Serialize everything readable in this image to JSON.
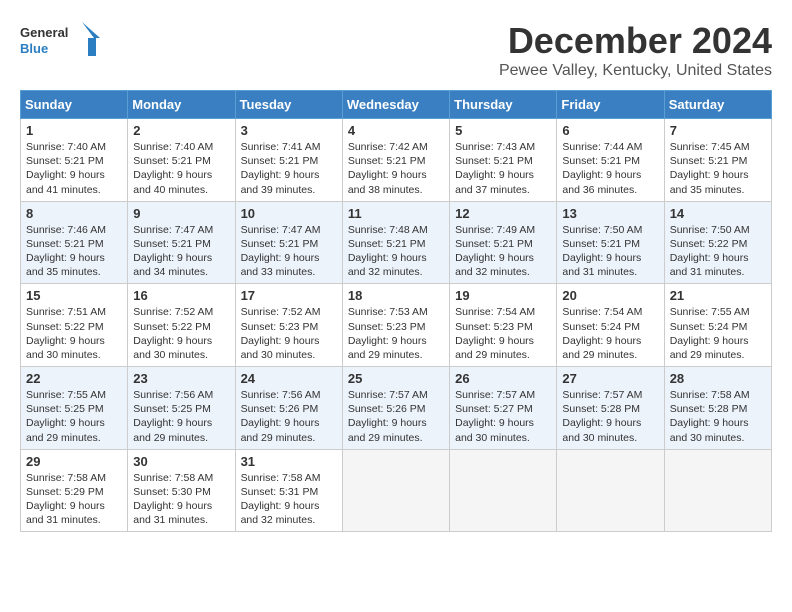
{
  "logo": {
    "line1": "General",
    "line2": "Blue"
  },
  "title": "December 2024",
  "location": "Pewee Valley, Kentucky, United States",
  "days_of_week": [
    "Sunday",
    "Monday",
    "Tuesday",
    "Wednesday",
    "Thursday",
    "Friday",
    "Saturday"
  ],
  "weeks": [
    [
      {
        "day": "1",
        "sunrise": "7:40 AM",
        "sunset": "5:21 PM",
        "daylight": "9 hours and 41 minutes."
      },
      {
        "day": "2",
        "sunrise": "7:40 AM",
        "sunset": "5:21 PM",
        "daylight": "9 hours and 40 minutes."
      },
      {
        "day": "3",
        "sunrise": "7:41 AM",
        "sunset": "5:21 PM",
        "daylight": "9 hours and 39 minutes."
      },
      {
        "day": "4",
        "sunrise": "7:42 AM",
        "sunset": "5:21 PM",
        "daylight": "9 hours and 38 minutes."
      },
      {
        "day": "5",
        "sunrise": "7:43 AM",
        "sunset": "5:21 PM",
        "daylight": "9 hours and 37 minutes."
      },
      {
        "day": "6",
        "sunrise": "7:44 AM",
        "sunset": "5:21 PM",
        "daylight": "9 hours and 36 minutes."
      },
      {
        "day": "7",
        "sunrise": "7:45 AM",
        "sunset": "5:21 PM",
        "daylight": "9 hours and 35 minutes."
      }
    ],
    [
      {
        "day": "8",
        "sunrise": "7:46 AM",
        "sunset": "5:21 PM",
        "daylight": "9 hours and 35 minutes."
      },
      {
        "day": "9",
        "sunrise": "7:47 AM",
        "sunset": "5:21 PM",
        "daylight": "9 hours and 34 minutes."
      },
      {
        "day": "10",
        "sunrise": "7:47 AM",
        "sunset": "5:21 PM",
        "daylight": "9 hours and 33 minutes."
      },
      {
        "day": "11",
        "sunrise": "7:48 AM",
        "sunset": "5:21 PM",
        "daylight": "9 hours and 32 minutes."
      },
      {
        "day": "12",
        "sunrise": "7:49 AM",
        "sunset": "5:21 PM",
        "daylight": "9 hours and 32 minutes."
      },
      {
        "day": "13",
        "sunrise": "7:50 AM",
        "sunset": "5:21 PM",
        "daylight": "9 hours and 31 minutes."
      },
      {
        "day": "14",
        "sunrise": "7:50 AM",
        "sunset": "5:22 PM",
        "daylight": "9 hours and 31 minutes."
      }
    ],
    [
      {
        "day": "15",
        "sunrise": "7:51 AM",
        "sunset": "5:22 PM",
        "daylight": "9 hours and 30 minutes."
      },
      {
        "day": "16",
        "sunrise": "7:52 AM",
        "sunset": "5:22 PM",
        "daylight": "9 hours and 30 minutes."
      },
      {
        "day": "17",
        "sunrise": "7:52 AM",
        "sunset": "5:23 PM",
        "daylight": "9 hours and 30 minutes."
      },
      {
        "day": "18",
        "sunrise": "7:53 AM",
        "sunset": "5:23 PM",
        "daylight": "9 hours and 29 minutes."
      },
      {
        "day": "19",
        "sunrise": "7:54 AM",
        "sunset": "5:23 PM",
        "daylight": "9 hours and 29 minutes."
      },
      {
        "day": "20",
        "sunrise": "7:54 AM",
        "sunset": "5:24 PM",
        "daylight": "9 hours and 29 minutes."
      },
      {
        "day": "21",
        "sunrise": "7:55 AM",
        "sunset": "5:24 PM",
        "daylight": "9 hours and 29 minutes."
      }
    ],
    [
      {
        "day": "22",
        "sunrise": "7:55 AM",
        "sunset": "5:25 PM",
        "daylight": "9 hours and 29 minutes."
      },
      {
        "day": "23",
        "sunrise": "7:56 AM",
        "sunset": "5:25 PM",
        "daylight": "9 hours and 29 minutes."
      },
      {
        "day": "24",
        "sunrise": "7:56 AM",
        "sunset": "5:26 PM",
        "daylight": "9 hours and 29 minutes."
      },
      {
        "day": "25",
        "sunrise": "7:57 AM",
        "sunset": "5:26 PM",
        "daylight": "9 hours and 29 minutes."
      },
      {
        "day": "26",
        "sunrise": "7:57 AM",
        "sunset": "5:27 PM",
        "daylight": "9 hours and 30 minutes."
      },
      {
        "day": "27",
        "sunrise": "7:57 AM",
        "sunset": "5:28 PM",
        "daylight": "9 hours and 30 minutes."
      },
      {
        "day": "28",
        "sunrise": "7:58 AM",
        "sunset": "5:28 PM",
        "daylight": "9 hours and 30 minutes."
      }
    ],
    [
      {
        "day": "29",
        "sunrise": "7:58 AM",
        "sunset": "5:29 PM",
        "daylight": "9 hours and 31 minutes."
      },
      {
        "day": "30",
        "sunrise": "7:58 AM",
        "sunset": "5:30 PM",
        "daylight": "9 hours and 31 minutes."
      },
      {
        "day": "31",
        "sunrise": "7:58 AM",
        "sunset": "5:31 PM",
        "daylight": "9 hours and 32 minutes."
      },
      null,
      null,
      null,
      null
    ]
  ]
}
